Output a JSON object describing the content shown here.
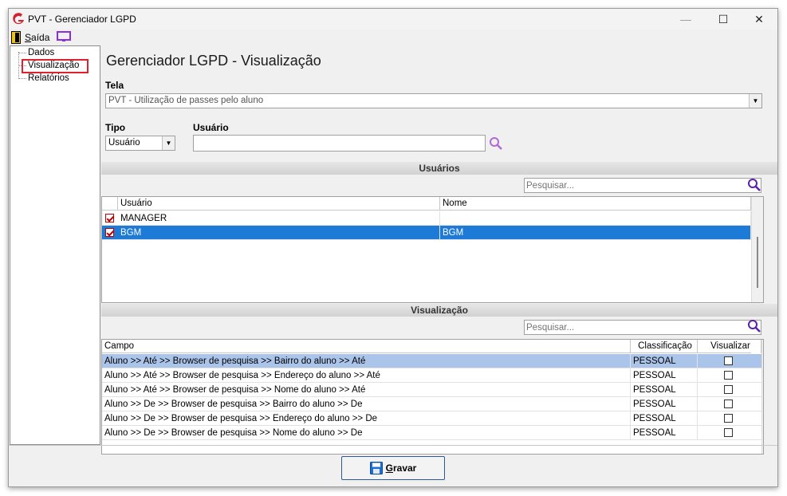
{
  "window": {
    "title": "PVT - Gerenciador LGPD",
    "minimize": "—",
    "maximize": "☐",
    "close": "✕"
  },
  "menu": {
    "exit_label": "Saída"
  },
  "sidebar": {
    "items": [
      {
        "label": "Dados"
      },
      {
        "label": "Visualização",
        "highlighted": true
      },
      {
        "label": "Relatórios"
      }
    ]
  },
  "main": {
    "title": "Gerenciador LGPD - Visualização",
    "tela_label": "Tela",
    "tela_value": "PVT - Utilização de passes pelo aluno",
    "tipo_label": "Tipo",
    "tipo_value": "Usuário",
    "usuario_label": "Usuário",
    "usuario_value": ""
  },
  "usuarios": {
    "header": "Usuários",
    "search_placeholder": "Pesquisar...",
    "columns": [
      "Usuário",
      "Nome"
    ],
    "rows": [
      {
        "usuario": "MANAGER",
        "nome": "",
        "checked": true,
        "selected": false
      },
      {
        "usuario": "BGM",
        "nome": "BGM",
        "checked": true,
        "selected": true
      }
    ]
  },
  "visualizacao": {
    "header": "Visualização",
    "search_placeholder": "Pesquisar...",
    "columns": [
      "Campo",
      "Classificação",
      "Visualizar"
    ],
    "rows": [
      {
        "campo": "Aluno >> Até >> Browser de pesquisa >> Bairro do aluno >> Até",
        "classificacao": "PESSOAL",
        "visualizar": false,
        "selected": true
      },
      {
        "campo": "Aluno >> Até >> Browser de pesquisa >> Endereço do aluno >> Até",
        "classificacao": "PESSOAL",
        "visualizar": false,
        "selected": false
      },
      {
        "campo": "Aluno >> Até >> Browser de pesquisa >> Nome do aluno >> Até",
        "classificacao": "PESSOAL",
        "visualizar": false,
        "selected": false
      },
      {
        "campo": "Aluno >> De >> Browser de pesquisa >> Bairro do aluno >> De",
        "classificacao": "PESSOAL",
        "visualizar": false,
        "selected": false
      },
      {
        "campo": "Aluno >> De >> Browser de pesquisa >> Endereço do aluno >> De",
        "classificacao": "PESSOAL",
        "visualizar": false,
        "selected": false
      },
      {
        "campo": "Aluno >> De >> Browser de pesquisa >> Nome do aluno >> De",
        "classificacao": "PESSOAL",
        "visualizar": false,
        "selected": false
      }
    ]
  },
  "footer": {
    "save_label": "Gravar"
  },
  "colors": {
    "selection": "#1e7ad7",
    "light_selection": "#aac4ea",
    "highlight_border": "#e0202a",
    "search_icon": "#7a2fc8",
    "app_logo": "#d3212d"
  },
  "icons": {
    "app": "app-logo-icon",
    "exit": "exit-door-icon",
    "screen": "monitor-icon",
    "search": "search-icon",
    "save": "floppy-disk-icon"
  }
}
